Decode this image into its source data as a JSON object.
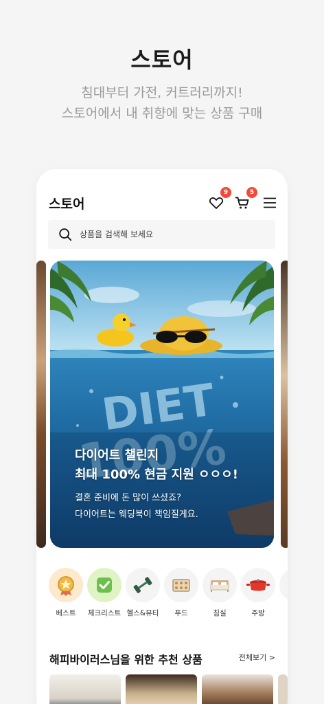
{
  "promo": {
    "title": "스토어",
    "subtitle_line1": "침대부터 가전, 커트러리까지!",
    "subtitle_line2": "스토어에서 내 취향에 맞는 상품 구매"
  },
  "app": {
    "title": "스토어",
    "wishlist_count": "9",
    "cart_count": "5",
    "icons": [
      "heart-icon",
      "cart-icon",
      "menu-icon",
      "search-icon"
    ]
  },
  "search": {
    "placeholder": "상품을 검색해 보세요"
  },
  "banner": {
    "art_text": "DIET 100%",
    "title_line1": "다이어트 챌린지",
    "title_line2": "최대 100% 현금 지원 ㅇㅇㅇ!",
    "desc_line1": "결혼 준비에 돈 많이 쓰셨죠?",
    "desc_line2": "다이어트는 웨딩북이 책임질게요."
  },
  "categories": [
    {
      "label": "베스트",
      "icon": "medal-icon",
      "bg": "#fde9cc"
    },
    {
      "label": "체크리스트",
      "icon": "checkbox-icon",
      "bg": "#dff3c4"
    },
    {
      "label": "헬스&뷰티",
      "icon": "dumbbell-icon",
      "bg": "#f4f4f4"
    },
    {
      "label": "푸드",
      "icon": "food-box-icon",
      "bg": "#f4f4f4"
    },
    {
      "label": "침실",
      "icon": "bed-icon",
      "bg": "#f4f4f4"
    },
    {
      "label": "주방",
      "icon": "pot-icon",
      "bg": "#f4f4f4"
    }
  ],
  "recommend": {
    "title": "해피바이러스님을 위한 추천 상품",
    "see_all": "전체보기 >"
  },
  "colors": {
    "badge": "#ef4a3a",
    "subtitle": "#9a9a9a"
  }
}
